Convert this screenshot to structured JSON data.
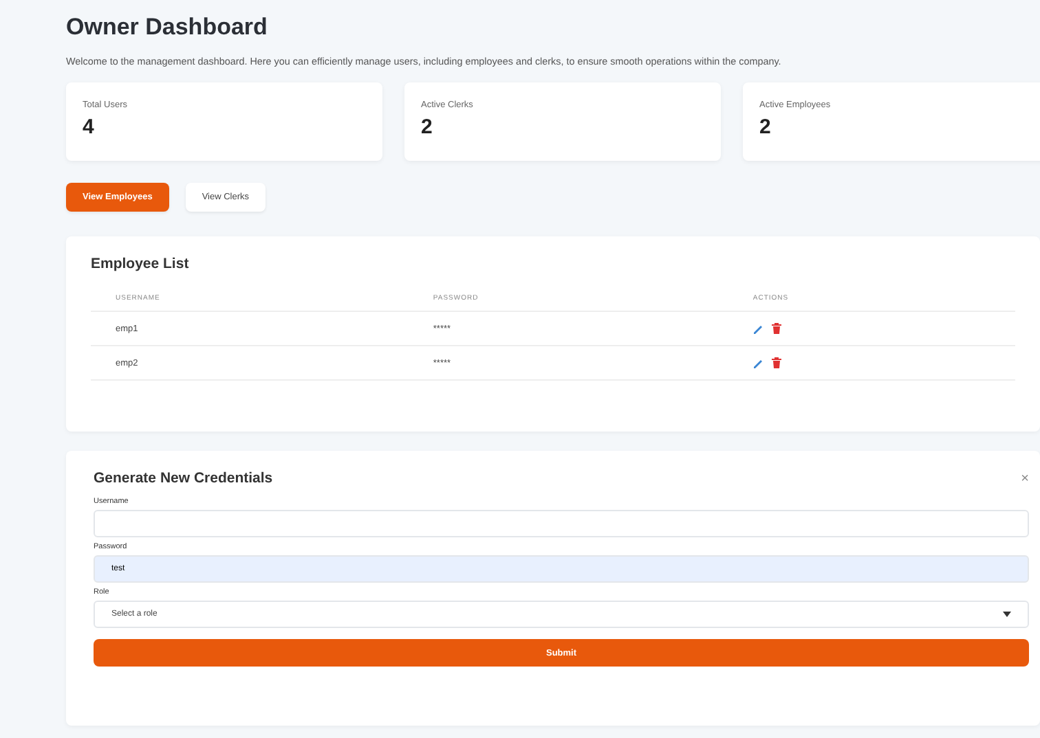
{
  "title": "Owner Dashboard",
  "description": "Welcome to the management dashboard. Here you can efficiently manage users, including employees and clerks, to ensure smooth operations within the company.",
  "stats": [
    {
      "label": "Total Users",
      "value": "4"
    },
    {
      "label": "Active Clerks",
      "value": "2"
    },
    {
      "label": "Active Employees",
      "value": "2"
    }
  ],
  "tabs": [
    {
      "label": "View Employees",
      "selected": true
    },
    {
      "label": "View Clerks",
      "selected": false
    }
  ],
  "employee_list": {
    "title": "Employee List",
    "columns": [
      "USERNAME",
      "PASSWORD",
      "ACTIONS"
    ],
    "rows": [
      {
        "username": "emp1",
        "password": "*****"
      },
      {
        "username": "emp2",
        "password": "*****"
      }
    ]
  },
  "credentials_form": {
    "title": "Generate New Credentials",
    "close": "×",
    "fields": [
      {
        "label": "Username",
        "kind": "text"
      },
      {
        "label": "Password",
        "kind": "password",
        "value": "test"
      },
      {
        "label": "Role",
        "kind": "select",
        "placeholder": "Select a role"
      }
    ],
    "submit": "Submit"
  }
}
